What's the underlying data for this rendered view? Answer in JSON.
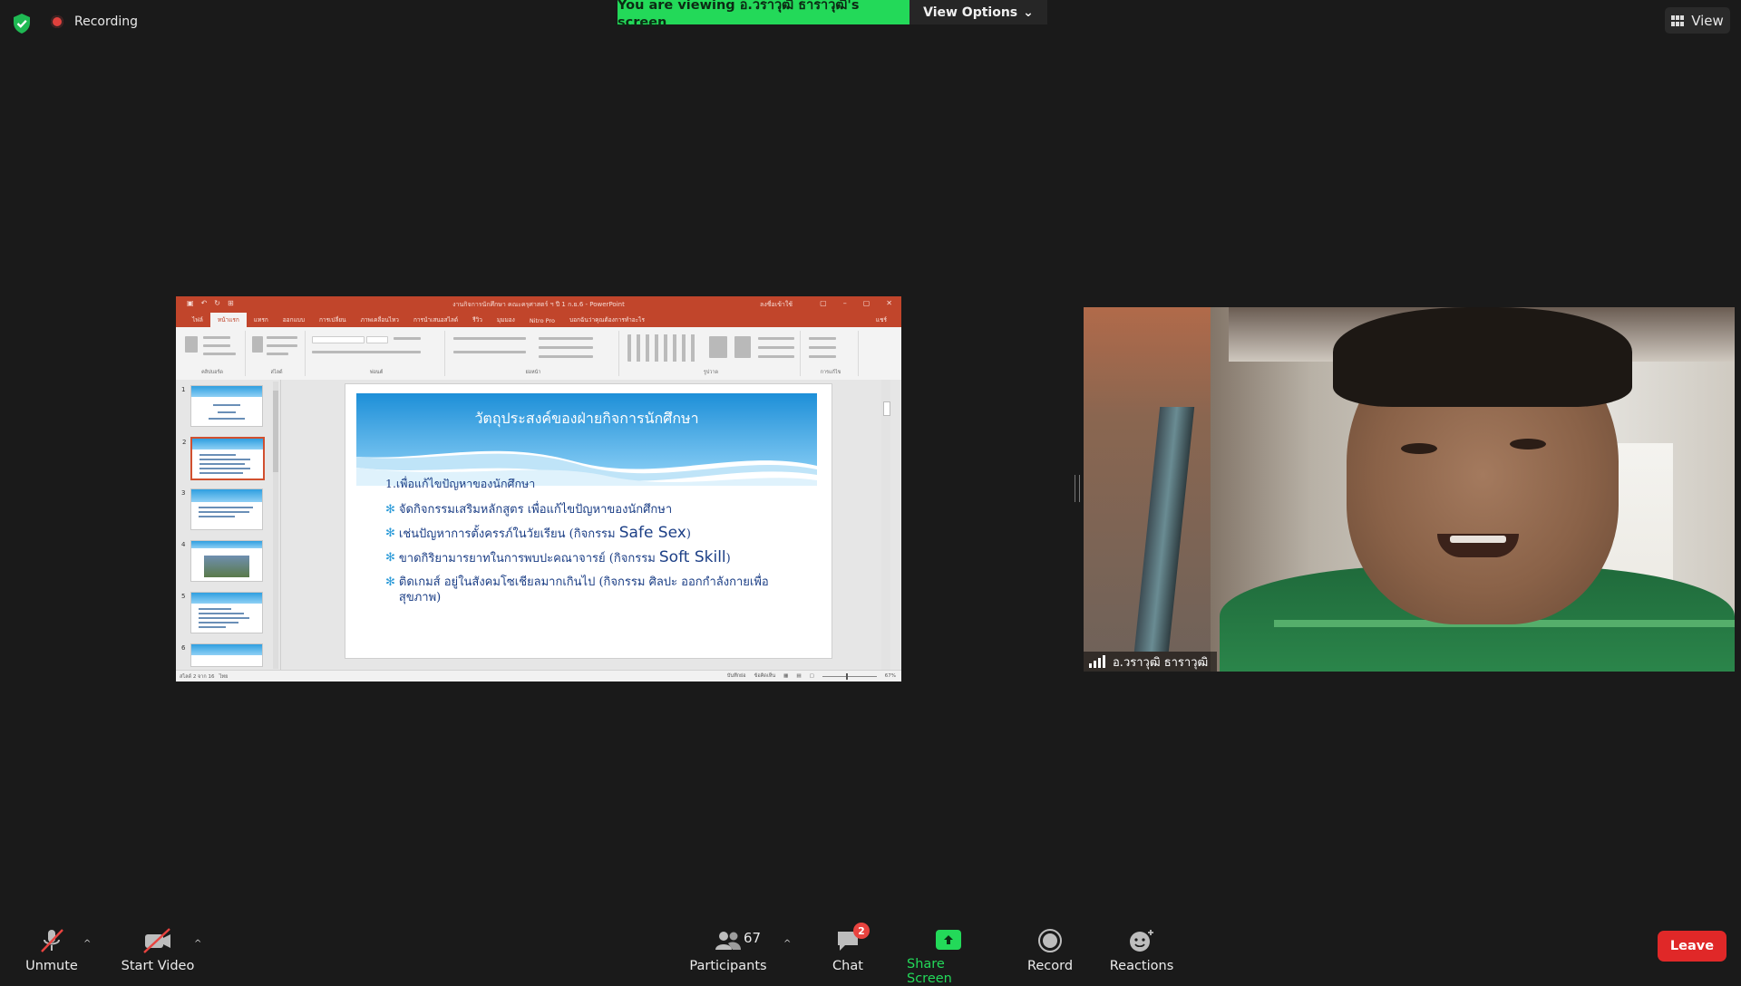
{
  "top": {
    "recording_label": "Recording",
    "viewing_banner": "You are viewing อ.วราวุฒิ ธาราวุฒิ's screen",
    "view_options_label": "View Options",
    "view_label": "View"
  },
  "ppt": {
    "window_title": "งานกิจการนักศึกษา คณะครุศาสตร์ ฯ ปี 1 ก.ย.6 - PowerPoint",
    "signin": "ลงชื่อเข้าใช้",
    "tabs": [
      "ไฟล์",
      "หน้าแรก",
      "แทรก",
      "ออกแบบ",
      "การเปลี่ยน",
      "ภาพเคลื่อนไหว",
      "การนำเสนอสไลด์",
      "รีวิว",
      "มุมมอง",
      "Nitro Pro",
      "บอกฉันว่าคุณต้องการทำอะไร"
    ],
    "share_btn": "แชร์",
    "ribbon_groups": [
      "คลิปบอร์ด",
      "สไลด์",
      "ฟอนต์",
      "ย่อหน้า",
      "รูปวาด",
      "การแก้ไข"
    ],
    "slide": {
      "title": "วัตถุประสงค์ของฝ่ายกิจการนักศึกษา",
      "point1": "1.เพื่อแก้ไขปัญหาของนักศึกษา",
      "bullets": [
        {
          "text": "จัดกิจกรรมเสริมหลักสูตร เพื่อแก้ไขปัญหาของนักศึกษา",
          "hl": "",
          "tail": ""
        },
        {
          "text": "เช่นปัญหาการตั้งครรภ์ในวัยเรียน (กิจกรรม ",
          "hl": "Safe Sex",
          "tail": ")"
        },
        {
          "text": "ขาดกิริยามารยาทในการพบปะคณาจารย์ (กิจกรรม ",
          "hl": "Soft Skill",
          "tail": ")"
        },
        {
          "text": "ติดเกมส์ อยู่ในสังคมโซเชียลมากเกินไป (กิจกรรม ศิลปะ ออกกำลังกายเพื่อสุขภาพ)",
          "hl": "",
          "tail": ""
        }
      ]
    },
    "thumb_numbers": [
      "1",
      "2",
      "3",
      "4",
      "5",
      "6"
    ],
    "status_left": "สไลด์ 2 จาก 16",
    "status_lang": "ไทย",
    "status_notes": "บันทึกย่อ",
    "status_comments": "ข้อคิดเห็น",
    "zoom": "67%"
  },
  "video": {
    "participant_name": "อ.วราวุฒิ ธาราวุฒิ"
  },
  "toolbar": {
    "unmute": "Unmute",
    "start_video": "Start Video",
    "participants": "Participants",
    "participant_count": "67",
    "chat": "Chat",
    "chat_badge": "2",
    "share_screen": "Share Screen",
    "record": "Record",
    "reactions": "Reactions",
    "leave": "Leave"
  },
  "colors": {
    "banner_green": "#23d959",
    "ppt_red": "#c1452b",
    "leave_red": "#e02828",
    "badge_red": "#e8433f"
  }
}
